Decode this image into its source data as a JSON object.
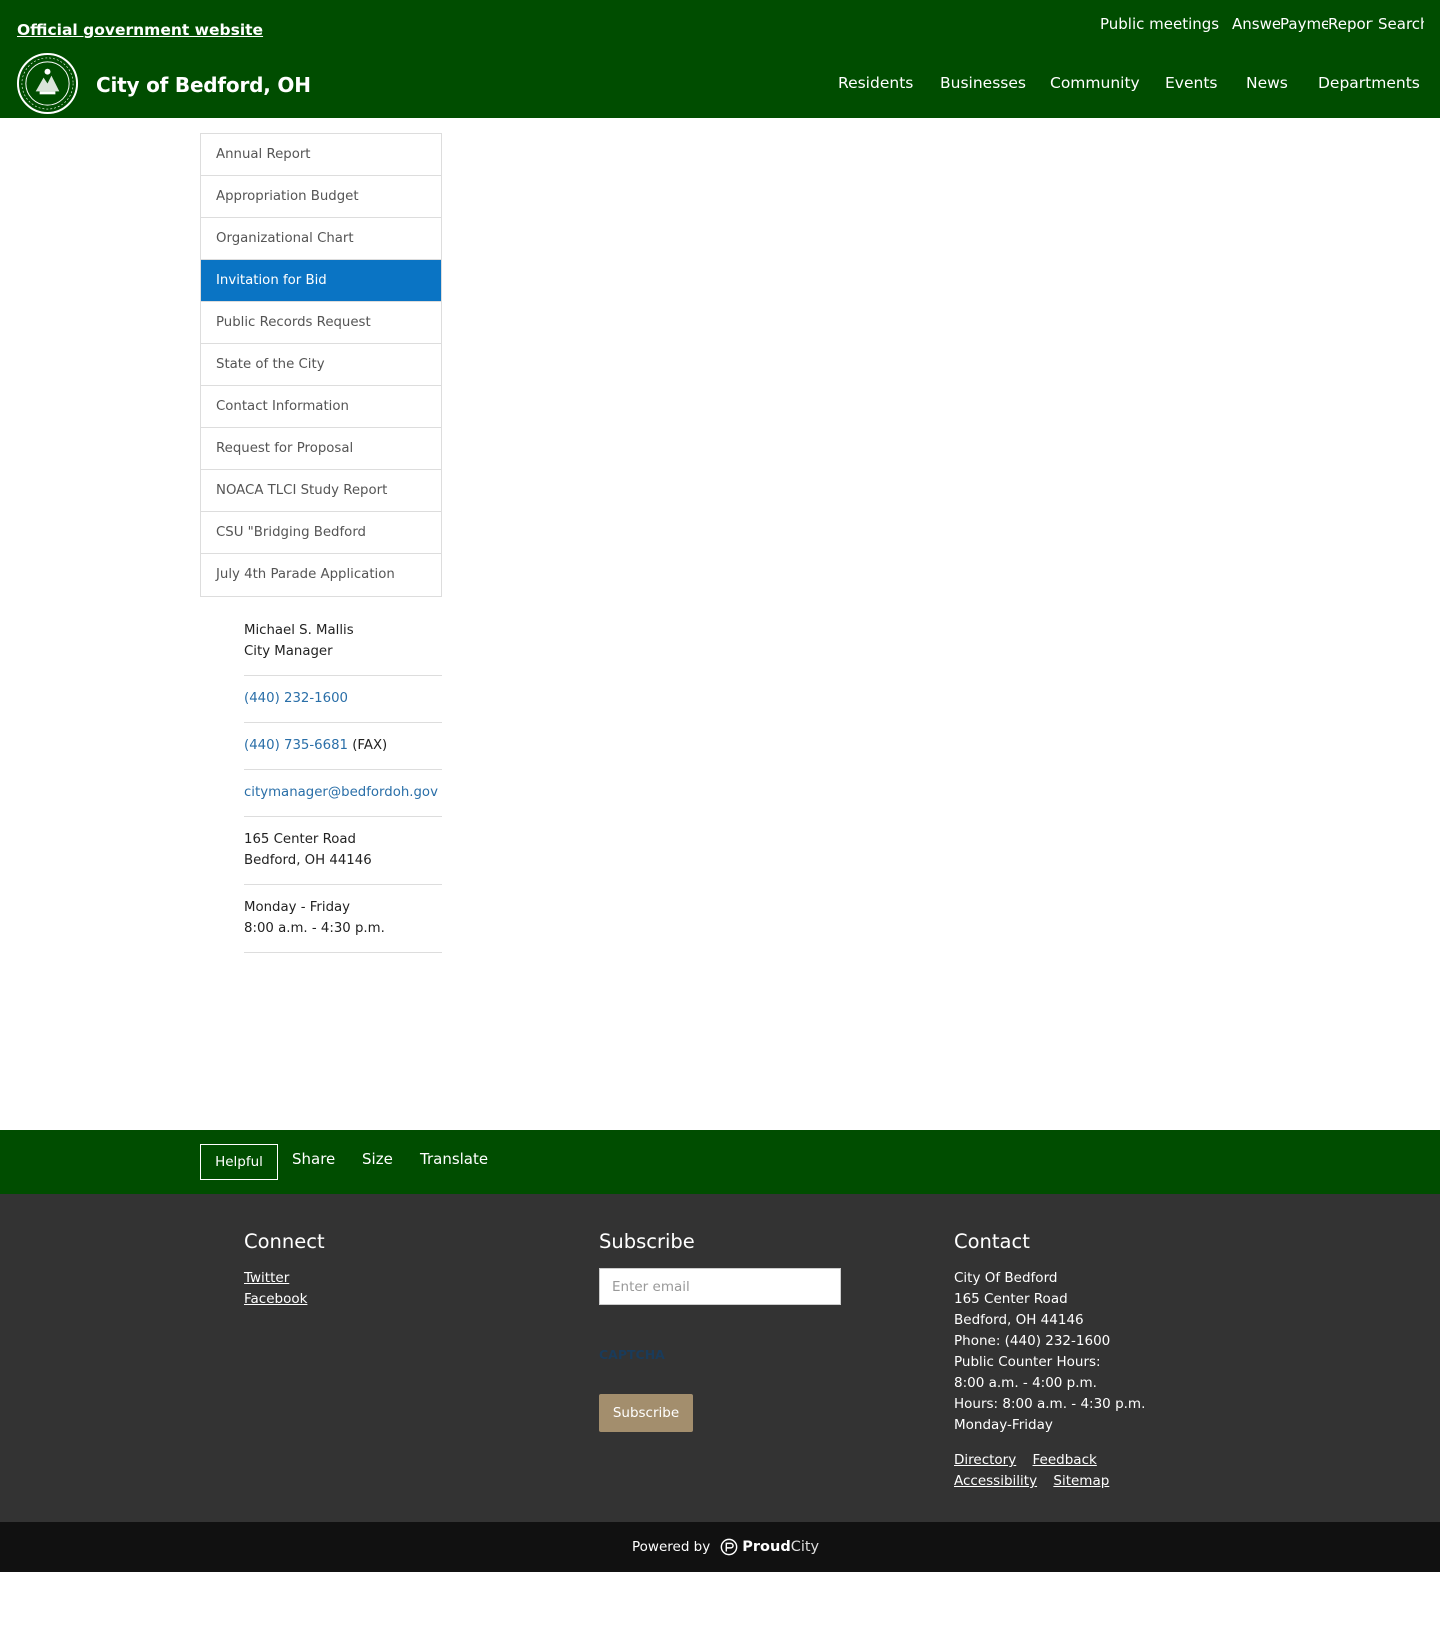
{
  "header": {
    "official_label": "Official government website",
    "site_title": "City of Bedford, OH",
    "top_links": [
      "Public meetings",
      "Answe",
      "Payme",
      "Report",
      "Search"
    ],
    "nav": [
      "Residents",
      "Businesses",
      "Community",
      "Events",
      "News",
      "Departments"
    ],
    "colors": {
      "header_bg": "#004d00",
      "active_menu": "#0a74c4",
      "subscribe_btn": "#a38e6d"
    }
  },
  "sidebar": {
    "items": [
      "Annual Report",
      "Appropriation Budget",
      "Organizational Chart",
      "Invitation for Bid",
      "Public Records Request",
      "State of the City",
      "Contact Information",
      "Request for Proposal",
      "NOACA TLCI Study Report",
      "CSU \"Bridging Bedford",
      "July 4th Parade Application"
    ],
    "active_item": "Invitation for Bid"
  },
  "contact_block": {
    "name": "Michael S. Mallis",
    "title": "City Manager",
    "phone": "(440) 232-1600",
    "fax": "(440) 735-6681",
    "fax_suffix": "(FAX)",
    "email": "citymanager@bedfordoh.gov",
    "address_line1": "165 Center Road",
    "address_line2": "Bedford, OH 44146",
    "hours_line1": "Monday - Friday",
    "hours_line2": "8:00 a.m. - 4:30 p.m."
  },
  "actionbar": {
    "helpful": "Helpful",
    "share": "Share",
    "size": "Size",
    "translate": "Translate"
  },
  "footer": {
    "connect": {
      "heading": "Connect",
      "links": [
        "Twitter",
        "Facebook"
      ]
    },
    "subscribe": {
      "heading": "Subscribe",
      "email_placeholder": "Enter email",
      "captcha_label": "CAPTCHA",
      "button": "Subscribe"
    },
    "contact": {
      "heading": "Contact",
      "lines": [
        "City Of Bedford",
        "165 Center Road",
        "Bedford, OH 44146",
        "Phone: (440) 232-1600",
        "Public Counter Hours:",
        "8:00 a.m. - 4:00 p.m.",
        "Hours: 8:00 a.m. - 4:30 p.m.",
        "Monday-Friday"
      ],
      "links_row1": [
        "Directory",
        "Feedback"
      ],
      "links_row2": [
        "Accessibility",
        "Sitemap"
      ]
    }
  },
  "powered": {
    "label": "Powered by",
    "brand_bold": "Proud",
    "brand_light": "City"
  }
}
